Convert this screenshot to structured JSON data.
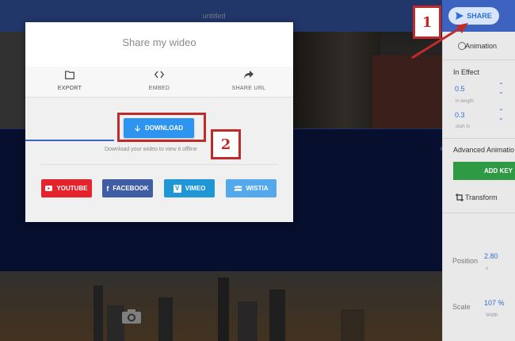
{
  "app": {
    "title": "untitled",
    "share_label": "SHARE"
  },
  "dialog": {
    "title": "Share my wideo",
    "tabs": [
      {
        "label": "EXPORT",
        "icon": "folder-icon",
        "active": true
      },
      {
        "label": "EMBED",
        "icon": "code-icon",
        "active": false
      },
      {
        "label": "SHARE URL",
        "icon": "share-arrow-icon",
        "active": false
      }
    ],
    "download_label": "DOWNLOAD",
    "download_hint": "Download your wideo to view it offline",
    "social": [
      {
        "label": "YOUTUBE",
        "icon": "youtube-icon",
        "color": "#e5232d"
      },
      {
        "label": "FACEBOOK",
        "icon": "facebook-icon",
        "color": "#3f5da4"
      },
      {
        "label": "VIMEO",
        "icon": "vimeo-icon",
        "color": "#1f97d6"
      },
      {
        "label": "WISTIA",
        "icon": "wistia-icon",
        "color": "#54a9ec"
      }
    ]
  },
  "right_panel": {
    "animation_label": "Animation",
    "in_effect_label": "In Effect",
    "in_length_value": "0.5",
    "in_length_label": "in length",
    "start_value": "0.3",
    "start_label": "start in",
    "advanced_label": "Advanced Animatio",
    "add_key_label": "ADD KEY",
    "transform_label": "Transform",
    "position_label": "Position",
    "position_value": "2.80",
    "position_axis": "x",
    "scale_label": "Scale",
    "scale_value": "107 %",
    "scale_sub": "Width"
  },
  "annotations": {
    "callout_1": "1",
    "callout_2": "2"
  },
  "colors": {
    "accent": "#3d63c0",
    "download": "#2d95f0",
    "add_key": "#2e9a44",
    "annotation": "#c12a2a"
  }
}
